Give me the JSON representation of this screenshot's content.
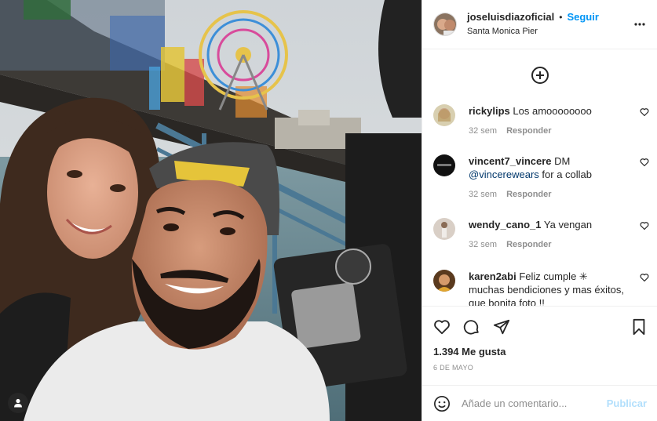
{
  "post": {
    "username": "joseluisdiazoficial",
    "separator": "•",
    "follow_label": "Seguir",
    "location": "Santa Monica Pier",
    "more_icon": "more-options-icon"
  },
  "comments": [
    {
      "username": "rickylips",
      "text": "Los amoooooooo",
      "time": "32 sem",
      "reply": "Responder"
    },
    {
      "username": "vincent7_vincere",
      "text_before": "DM",
      "mention": "@vincerewears",
      "text_after": "for a collab",
      "time": "32 sem",
      "reply": "Responder"
    },
    {
      "username": "wendy_cano_1",
      "text": "Ya vengan",
      "time": "32 sem",
      "reply": "Responder"
    },
    {
      "username": "karen2abi",
      "text": "Feliz cumple ✳ muchas bendiciones y mas éxitos, que bonita foto !!"
    }
  ],
  "stats": {
    "likes": "1.394 Me gusta",
    "date": "6 DE MAYO"
  },
  "composer": {
    "placeholder": "Añade un comentario...",
    "publish_label": "Publicar"
  },
  "colors": {
    "accent": "#0095f6",
    "publish_disabled": "#b2dffc",
    "muted": "#8e8e8e",
    "border": "#efefef"
  }
}
